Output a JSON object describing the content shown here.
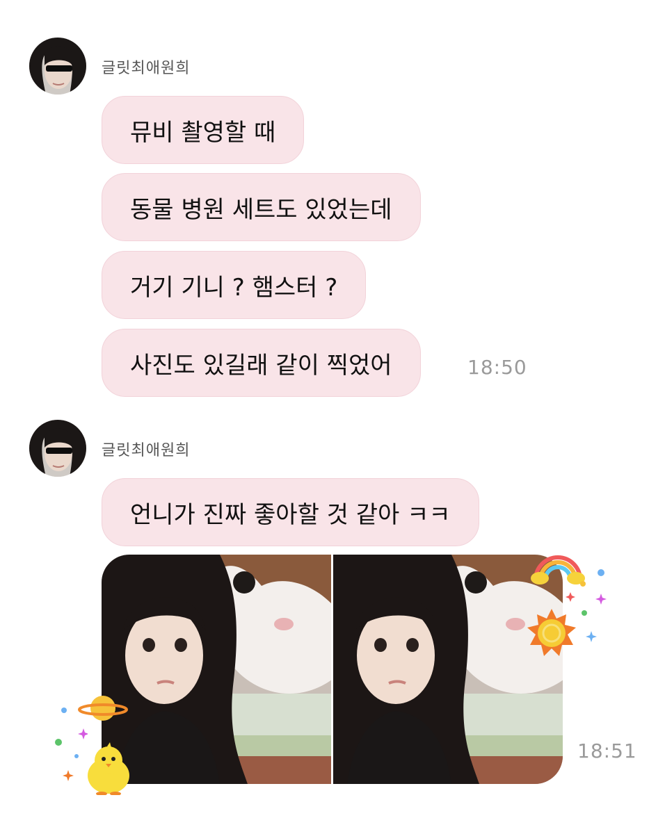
{
  "groups": [
    {
      "sender": "글릿최애원희",
      "messages": [
        "뮤비 촬영할 때",
        "동물 병원 세트도 있었는데",
        "거기 기니 ? 햄스터 ?",
        "사진도 있길래 같이 찍었어"
      ],
      "time": "18:50"
    },
    {
      "sender": "글릿최애원희",
      "messages": [
        "언니가 진짜 좋아할 것 같아 ㅋㅋ"
      ],
      "time": "18:51"
    }
  ],
  "colors": {
    "bubble_bg": "#f9e4e8",
    "bubble_border": "#f2d2d9",
    "time_text": "#9a9a9a",
    "sender_text": "#555555"
  },
  "stickers": [
    "rainbow-sticker",
    "sun-sticker",
    "planet-sticker",
    "chick-sticker",
    "sparkle-stickers"
  ]
}
